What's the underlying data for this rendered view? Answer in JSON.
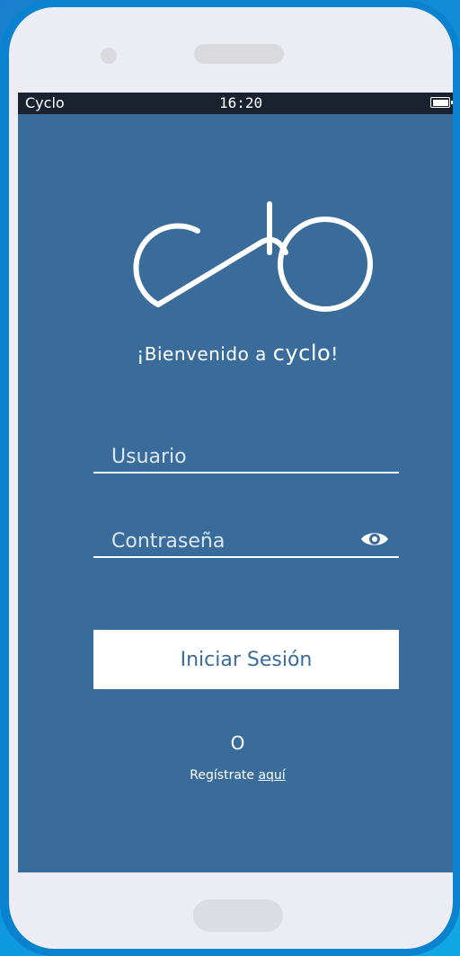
{
  "status_bar": {
    "app_name": "Cyclo",
    "time": "16:20",
    "battery_icon": "battery-icon"
  },
  "logo": {
    "icon": "bike-logo-icon"
  },
  "welcome": {
    "prefix": "¡Bienvenido a ",
    "brand": "cyclo",
    "suffix": "!"
  },
  "form": {
    "username_placeholder": "Usuario",
    "password_placeholder": "Contraseña",
    "show_password_icon": "eye-icon",
    "login_label": "Iniciar Sesión"
  },
  "alt": {
    "or_text": "O",
    "register_prefix": "Regístrate ",
    "register_link": "aquí"
  },
  "colors": {
    "screen_bg": "#3a6c9b",
    "status_bg": "#1a2230",
    "text": "#ffffff"
  }
}
